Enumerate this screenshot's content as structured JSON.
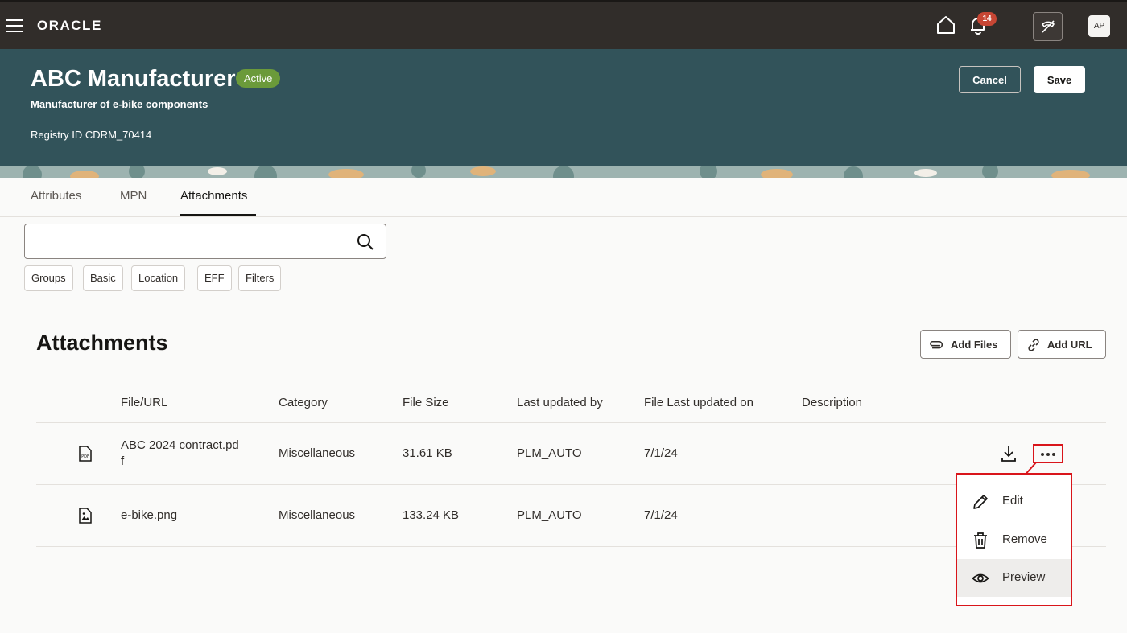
{
  "topbar": {
    "logo": "ORACLE",
    "notification_count": "14",
    "avatar_initials": "AP",
    "icons": [
      "menu-icon",
      "home-icon",
      "bell-icon",
      "sign-off-icon"
    ]
  },
  "header": {
    "title": "ABC Manufacturer",
    "status": "Active",
    "subtitle": "Manufacturer of e-bike components",
    "registry": "Registry ID CDRM_70414",
    "cancel_label": "Cancel",
    "save_label": "Save",
    "bg_color": "#32535a",
    "status_color": "#6b9a3a"
  },
  "tabs": [
    {
      "label": "Attributes"
    },
    {
      "label": "MPN"
    },
    {
      "label": "Attachments",
      "active": true
    }
  ],
  "search": {
    "value": "",
    "placeholder": ""
  },
  "filters": [
    "Groups",
    "Basic",
    "Location",
    "EFF",
    "Filters"
  ],
  "attachments": {
    "title": "Attachments",
    "add_files_label": "Add Files",
    "add_url_label": "Add URL",
    "columns": [
      "File/URL",
      "Category",
      "File Size",
      "Last updated by",
      "File Last updated on",
      "Description"
    ],
    "rows": [
      {
        "icon": "pdf-file-icon",
        "file": "ABC 2024 contract.pd",
        "file_wrap": "f",
        "category": "Miscellaneous",
        "size": "31.61 KB",
        "updated_by": "PLM_AUTO",
        "updated_on": "7/1/24",
        "description": ""
      },
      {
        "icon": "image-file-icon",
        "file": "e-bike.png",
        "file_wrap": "",
        "category": "Miscellaneous",
        "size": "133.24 KB",
        "updated_by": "PLM_AUTO",
        "updated_on": "7/1/24",
        "description": ""
      }
    ]
  },
  "menu": {
    "items": [
      {
        "label": "Edit",
        "icon": "pencil-icon"
      },
      {
        "label": "Remove",
        "icon": "trash-icon"
      },
      {
        "label": "Preview",
        "icon": "eye-icon",
        "highlighted": true
      }
    ],
    "highlight_color": "#d9151b"
  }
}
